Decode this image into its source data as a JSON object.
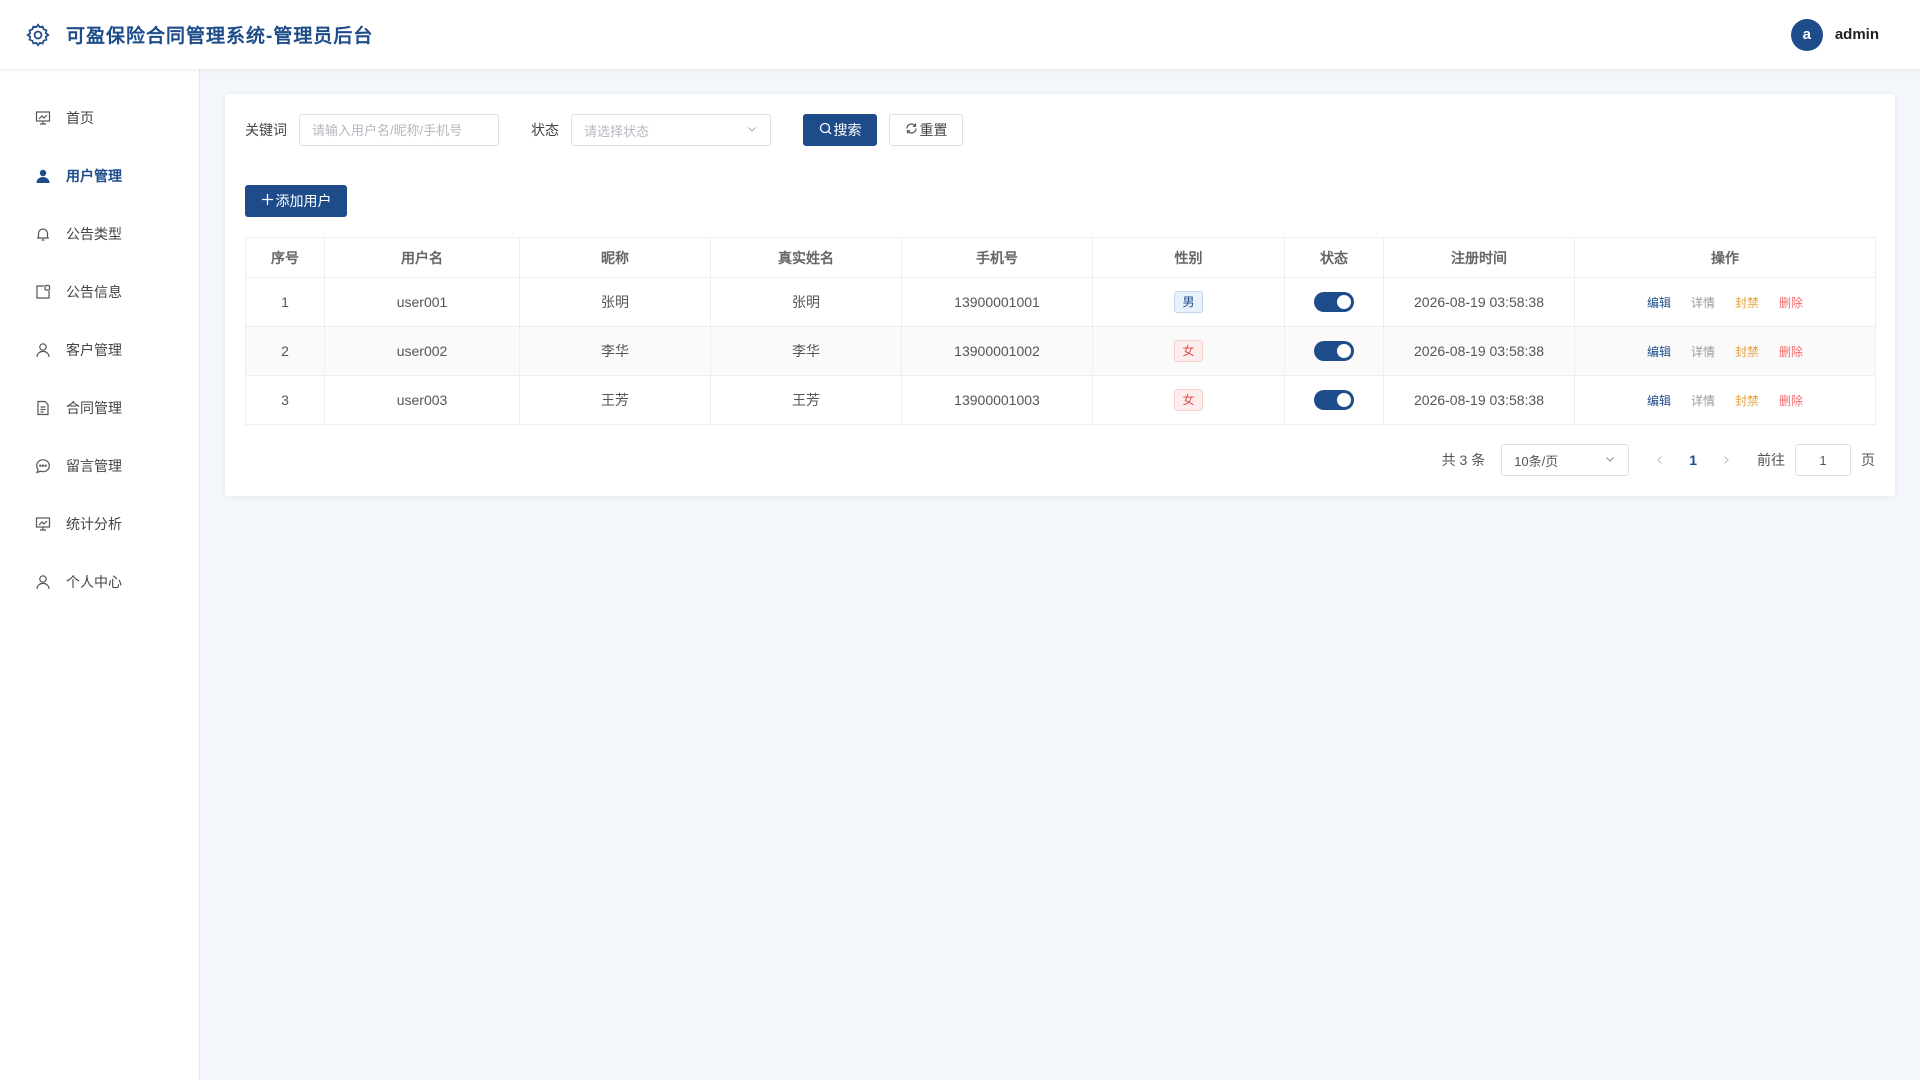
{
  "header": {
    "title": "可盈保险合同管理系统-管理员后台",
    "avatar_letter": "a",
    "username": "admin"
  },
  "sidebar": {
    "items": [
      {
        "label": "首页",
        "icon": "presentation-chart-icon",
        "active": false
      },
      {
        "label": "用户管理",
        "icon": "user-filled-icon",
        "active": true
      },
      {
        "label": "公告类型",
        "icon": "bell-icon",
        "active": false
      },
      {
        "label": "公告信息",
        "icon": "notice-board-icon",
        "active": false
      },
      {
        "label": "客户管理",
        "icon": "user-icon",
        "active": false
      },
      {
        "label": "合同管理",
        "icon": "document-icon",
        "active": false
      },
      {
        "label": "留言管理",
        "icon": "chat-bubble-icon",
        "active": false
      },
      {
        "label": "统计分析",
        "icon": "presentation-chart-icon",
        "active": false
      },
      {
        "label": "个人中心",
        "icon": "user-icon",
        "active": false
      }
    ]
  },
  "filters": {
    "keyword_label": "关键词",
    "keyword_placeholder": "请输入用户名/昵称/手机号",
    "status_label": "状态",
    "status_placeholder": "请选择状态",
    "search_label": "搜索",
    "reset_label": "重置"
  },
  "actions": {
    "add_label": "添加用户"
  },
  "table": {
    "columns": [
      "序号",
      "用户名",
      "昵称",
      "真实姓名",
      "手机号",
      "性别",
      "状态",
      "注册时间",
      "操作"
    ],
    "rows": [
      {
        "index": "1",
        "username": "user001",
        "nickname": "张明",
        "realname": "张明",
        "phone": "13900001001",
        "gender": "男",
        "enabled": true,
        "created": "2026-08-19 03:58:38"
      },
      {
        "index": "2",
        "username": "user002",
        "nickname": "李华",
        "realname": "李华",
        "phone": "13900001002",
        "gender": "女",
        "enabled": true,
        "created": "2026-08-19 03:58:38"
      },
      {
        "index": "3",
        "username": "user003",
        "nickname": "王芳",
        "realname": "王芳",
        "phone": "13900001003",
        "gender": "女",
        "enabled": true,
        "created": "2026-08-19 03:58:38"
      }
    ],
    "ops": {
      "edit": "编辑",
      "detail": "详情",
      "ban": "封禁",
      "delete": "删除"
    }
  },
  "pagination": {
    "total_text": "共 3 条",
    "page_size": "10条/页",
    "current_page": "1",
    "goto_label": "前往",
    "goto_value": "1",
    "goto_unit": "页"
  },
  "colors": {
    "primary": "#1e4c8a",
    "warning": "#e6a23c",
    "danger": "#f56c6c",
    "background": "#f3f6fa"
  }
}
